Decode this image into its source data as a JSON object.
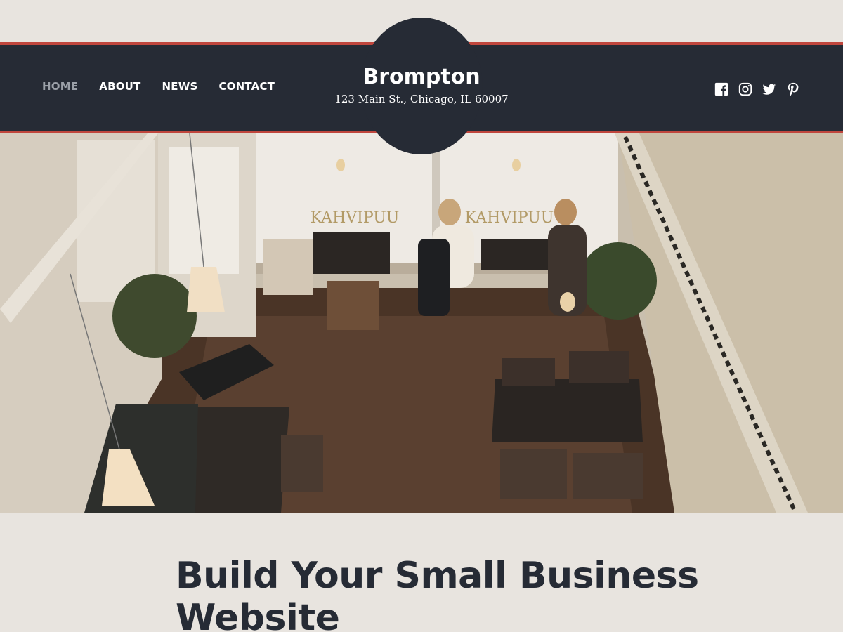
{
  "nav": {
    "items": [
      {
        "label": "HOME",
        "active": true
      },
      {
        "label": "ABOUT",
        "active": false
      },
      {
        "label": "NEWS",
        "active": false
      },
      {
        "label": "CONTACT",
        "active": false
      }
    ]
  },
  "brand": {
    "title": "Brompton",
    "address": "123 Main St., Chicago, IL 60007"
  },
  "social": {
    "icons": [
      "facebook-icon",
      "instagram-icon",
      "twitter-icon",
      "pinterest-icon"
    ]
  },
  "hero": {
    "window_text_left": "KAHVIPUU",
    "window_text_right": "KAHVIPUU"
  },
  "main": {
    "headline": "Build Your Small Business Website"
  },
  "colors": {
    "header_bg": "#262b35",
    "accent_stripe": "#c0463d",
    "page_bg": "#e8e4df",
    "nav_active": "#9ba0a8"
  }
}
